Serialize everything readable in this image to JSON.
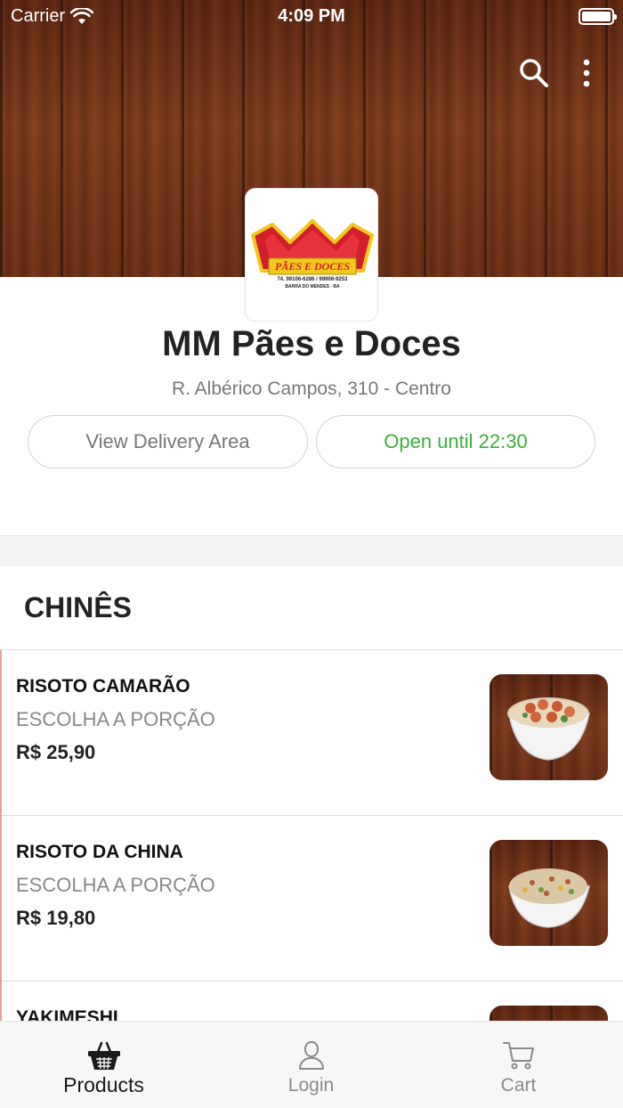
{
  "status_bar": {
    "carrier": "Carrier",
    "time": "4:09 PM"
  },
  "header": {
    "actions": [
      {
        "icon": "search-icon"
      },
      {
        "icon": "more-vertical-icon"
      }
    ],
    "logo": {
      "brand_text": "PÃES E DOCES",
      "phones": "74. 99106-6286 / 99906-9253",
      "city": "BARRA DO MENDES - BA",
      "brand_colors": [
        "#d21f2c",
        "#f2c81d"
      ]
    }
  },
  "store": {
    "name": "MM Pães e Doces",
    "address": "R. Albérico Campos, 310 - Centro",
    "delivery_button": "View Delivery Area",
    "open_status": "Open until 22:30",
    "open_color": "#3cae3c"
  },
  "section": {
    "title": "CHINÊS"
  },
  "products": [
    {
      "name": "RISOTO CAMARÃO",
      "description": "ESCOLHA A PORÇÃO",
      "price": "R$ 25,90"
    },
    {
      "name": "RISOTO DA CHINA",
      "description": "ESCOLHA A PORÇÃO",
      "price": "R$ 19,80"
    },
    {
      "name": "YAKIMESHI",
      "description": "",
      "price": ""
    }
  ],
  "tabbar": {
    "tabs": [
      {
        "label": "Products",
        "icon": "basket-icon",
        "active": true
      },
      {
        "label": "Login",
        "icon": "user-icon",
        "active": false
      },
      {
        "label": "Cart",
        "icon": "cart-icon",
        "active": false
      }
    ]
  }
}
